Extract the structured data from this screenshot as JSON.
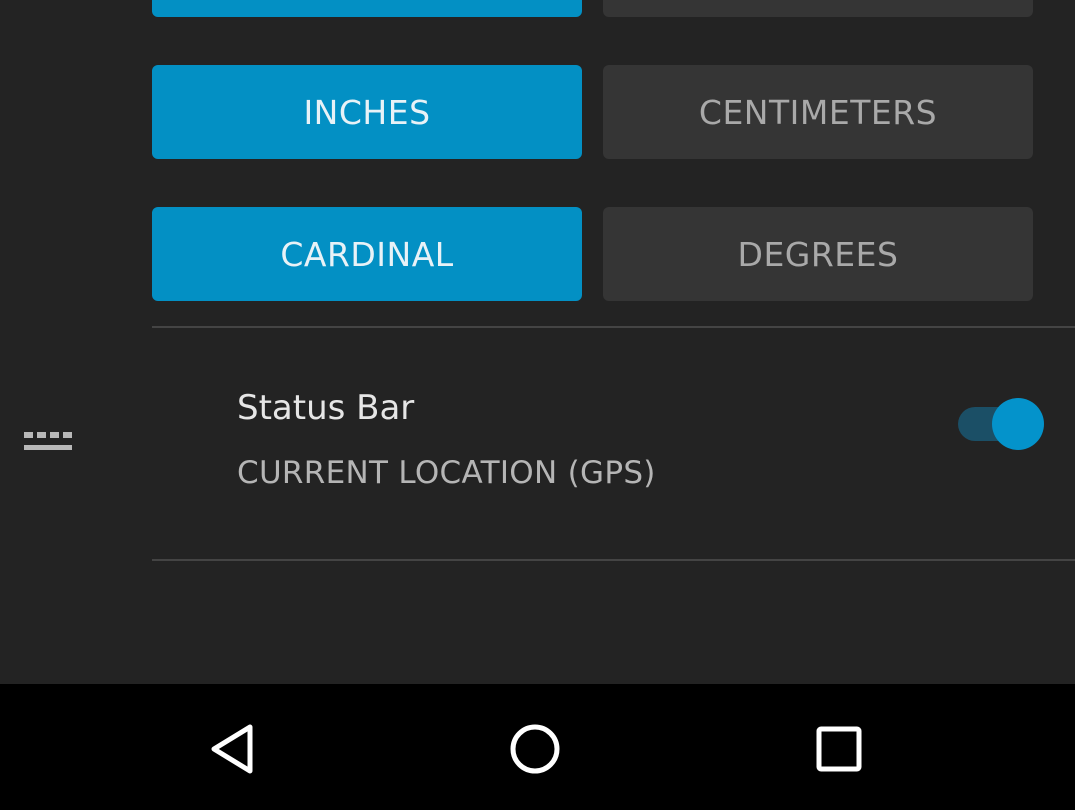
{
  "units_rows": [
    {
      "active_label": "",
      "inactive_label": ""
    },
    {
      "active_label": "INCHES",
      "inactive_label": "CENTIMETERS"
    },
    {
      "active_label": "CARDINAL",
      "inactive_label": "DEGREES"
    }
  ],
  "status_bar_setting": {
    "title": "Status Bar",
    "subtitle": "CURRENT LOCATION (GPS)",
    "enabled": true,
    "icon": "status-bar-icon"
  },
  "nav_bar": {
    "back": "back-icon",
    "home": "home-icon",
    "recents": "recents-icon"
  },
  "colors": {
    "active": "#0390c4",
    "inactive": "#353535",
    "background": "#232323",
    "toggle_on": "#0493cb"
  }
}
